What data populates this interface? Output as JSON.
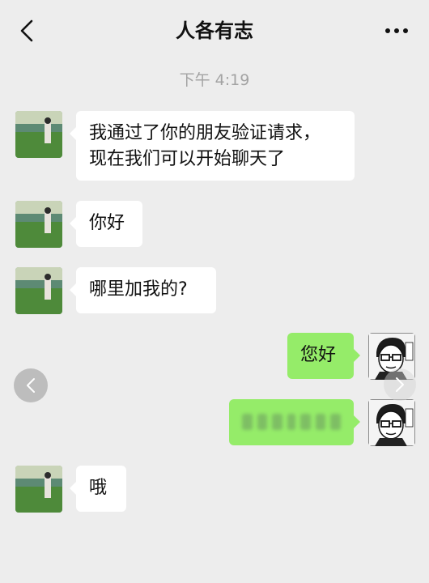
{
  "header": {
    "title": "人各有志",
    "back_icon": "chevron-left-icon",
    "more_icon": "ellipsis-icon"
  },
  "timestamp": "下午 4:19",
  "messages": [
    {
      "side": "left",
      "text_line1": "我通过了你的朋友验证请求，",
      "text_line2": "现在我们可以开始聊天了"
    },
    {
      "side": "left",
      "text": "你好"
    },
    {
      "side": "left",
      "text": "哪里加我的?"
    },
    {
      "side": "right",
      "text": "您好"
    },
    {
      "side": "right",
      "text": "",
      "note": "redacted"
    },
    {
      "side": "left",
      "text": "哦"
    }
  ],
  "colors": {
    "background": "#ededed",
    "bubble_left": "#ffffff",
    "bubble_right": "#95ec69",
    "timestamp": "#a3a3a3"
  }
}
